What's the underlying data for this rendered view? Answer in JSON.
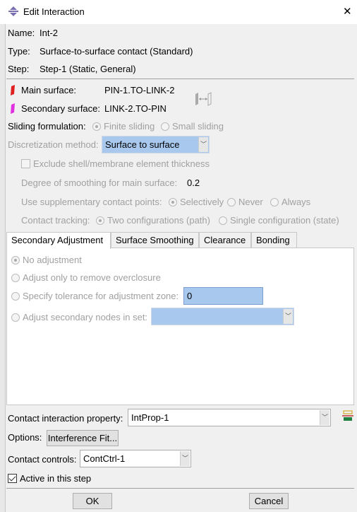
{
  "window": {
    "title": "Edit Interaction",
    "close": "✕"
  },
  "info": {
    "name_label": "Name:",
    "name": "Int-2",
    "type_label": "Type:",
    "type": "Surface-to-surface contact (Standard)",
    "step_label": "Step:",
    "step": "Step-1 (Static, General)"
  },
  "surfaces": {
    "main_label": "Main surface:",
    "main": "PIN-1.TO-LINK-2",
    "main_color": "#e02020",
    "secondary_label": "Secondary surface:",
    "secondary": "LINK-2.TO-PIN",
    "secondary_color": "#e030e0"
  },
  "sliding": {
    "label": "Sliding formulation:",
    "options": [
      "Finite sliding",
      "Small sliding"
    ],
    "selected": "Finite sliding"
  },
  "discretization": {
    "label": "Discretization method:",
    "value": "Surface to surface",
    "highlight": "#a9c8ee"
  },
  "exclude": {
    "label": "Exclude shell/membrane element thickness",
    "checked": false
  },
  "smoothing": {
    "label": "Degree of smoothing for main surface:",
    "value": "0.2"
  },
  "supplementary": {
    "label": "Use supplementary contact points:",
    "options": [
      "Selectively",
      "Never",
      "Always"
    ],
    "selected": "Selectively"
  },
  "tracking": {
    "label": "Contact tracking:",
    "options": [
      "Two configurations (path)",
      "Single configuration (state)"
    ],
    "selected": "Two configurations (path)"
  },
  "tabs": [
    {
      "label": "Secondary Adjustment",
      "active": true
    },
    {
      "label": "Surface Smoothing"
    },
    {
      "label": "Clearance"
    },
    {
      "label": "Bonding"
    }
  ],
  "adjustment": {
    "options": [
      "No adjustment",
      "Adjust only to remove overclosure",
      "Specify tolerance for adjustment zone:",
      "Adjust secondary nodes in set:"
    ],
    "selected": "No adjustment",
    "tolerance": "0",
    "node_set": ""
  },
  "property": {
    "label": "Contact interaction property:",
    "value": "IntProp-1"
  },
  "options": {
    "label": "Options:",
    "button": "Interference Fit..."
  },
  "controls": {
    "label": "Contact controls:",
    "value": "ContCtrl-1"
  },
  "active": {
    "label": "Active in this step",
    "checked": true
  },
  "buttons": {
    "ok": "OK",
    "cancel": "Cancel"
  }
}
